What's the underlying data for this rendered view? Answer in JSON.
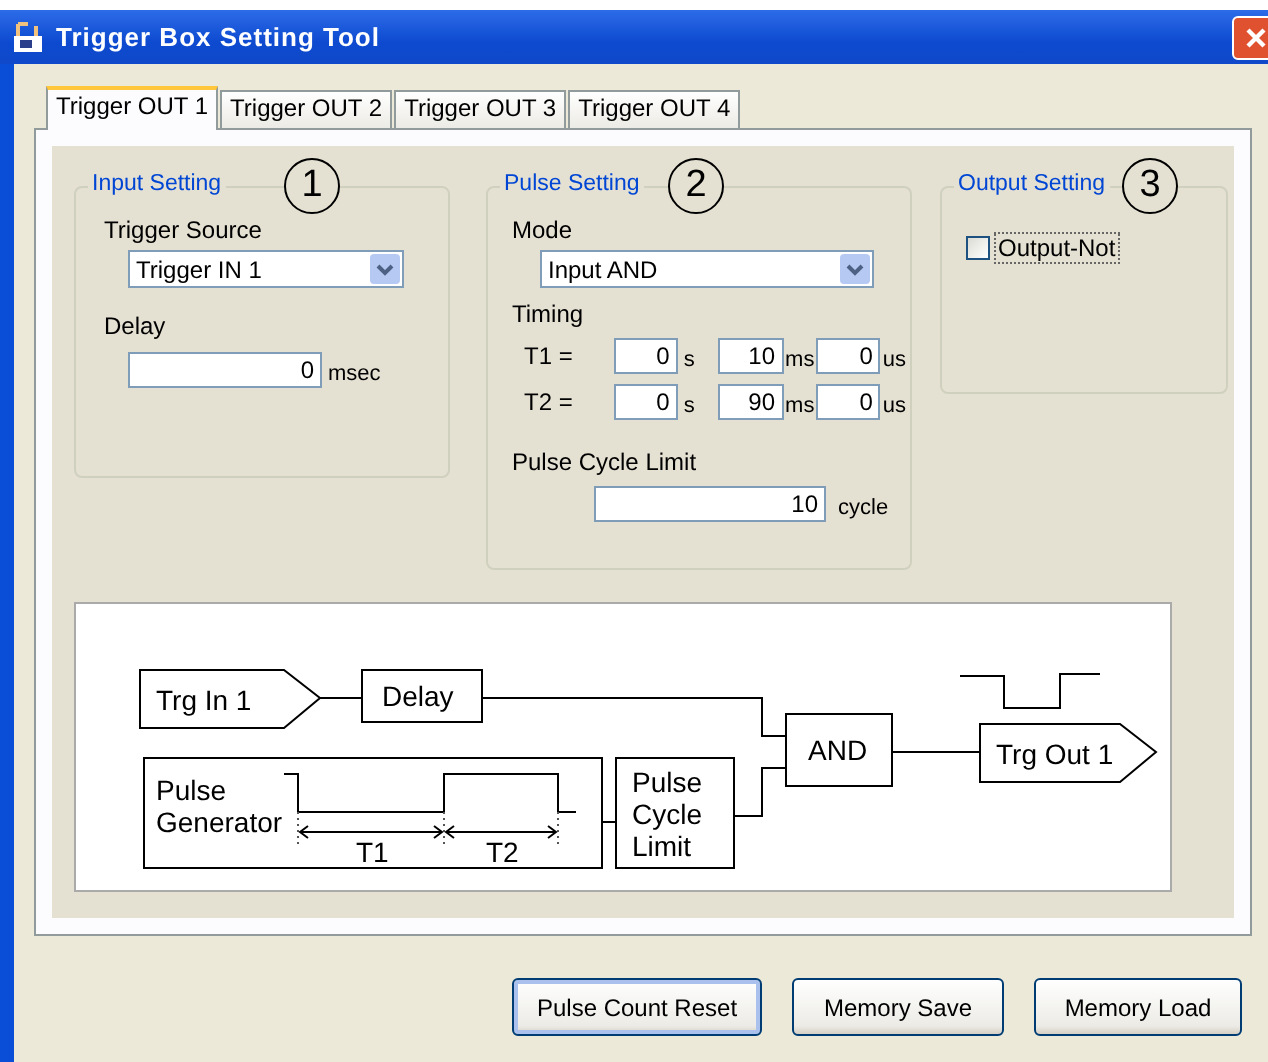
{
  "window": {
    "title": "Trigger Box Setting Tool"
  },
  "tabs": [
    {
      "label": "Trigger OUT 1",
      "selected": true
    },
    {
      "label": "Trigger OUT 2",
      "selected": false
    },
    {
      "label": "Trigger OUT 3",
      "selected": false
    },
    {
      "label": "Trigger OUT 4",
      "selected": false
    }
  ],
  "input_setting": {
    "title": "Input Setting",
    "marker": "1",
    "source_label": "Trigger Source",
    "source_value": "Trigger IN 1",
    "delay_label": "Delay",
    "delay_value": "0",
    "delay_unit": "msec"
  },
  "pulse_setting": {
    "title": "Pulse Setting",
    "marker": "2",
    "mode_label": "Mode",
    "mode_value": "Input AND",
    "timing_label": "Timing",
    "timing_rows": [
      {
        "label": "T1 =",
        "s": "0",
        "s_unit": "s",
        "ms": "10",
        "ms_unit": "ms",
        "us": "0",
        "us_unit": "us"
      },
      {
        "label": "T2 =",
        "s": "0",
        "s_unit": "s",
        "ms": "90",
        "ms_unit": "ms",
        "us": "0",
        "us_unit": "us"
      }
    ],
    "cycle_label": "Pulse Cycle Limit",
    "cycle_value": "10",
    "cycle_unit": "cycle"
  },
  "output_setting": {
    "title": "Output Setting",
    "marker": "3",
    "checkbox_label": "Output-Not",
    "checked": false
  },
  "diagram": {
    "input": "Trg In 1",
    "delay": "Delay",
    "gate": "AND",
    "output": "Trg Out 1",
    "generator": [
      "Pulse",
      "Generator"
    ],
    "limit": [
      "Pulse",
      "Cycle",
      "Limit"
    ],
    "t1": "T1",
    "t2": "T2"
  },
  "buttons": [
    {
      "label": "Pulse Count Reset",
      "default": true
    },
    {
      "label": "Memory Save",
      "default": false
    },
    {
      "label": "Memory Load",
      "default": false
    }
  ]
}
